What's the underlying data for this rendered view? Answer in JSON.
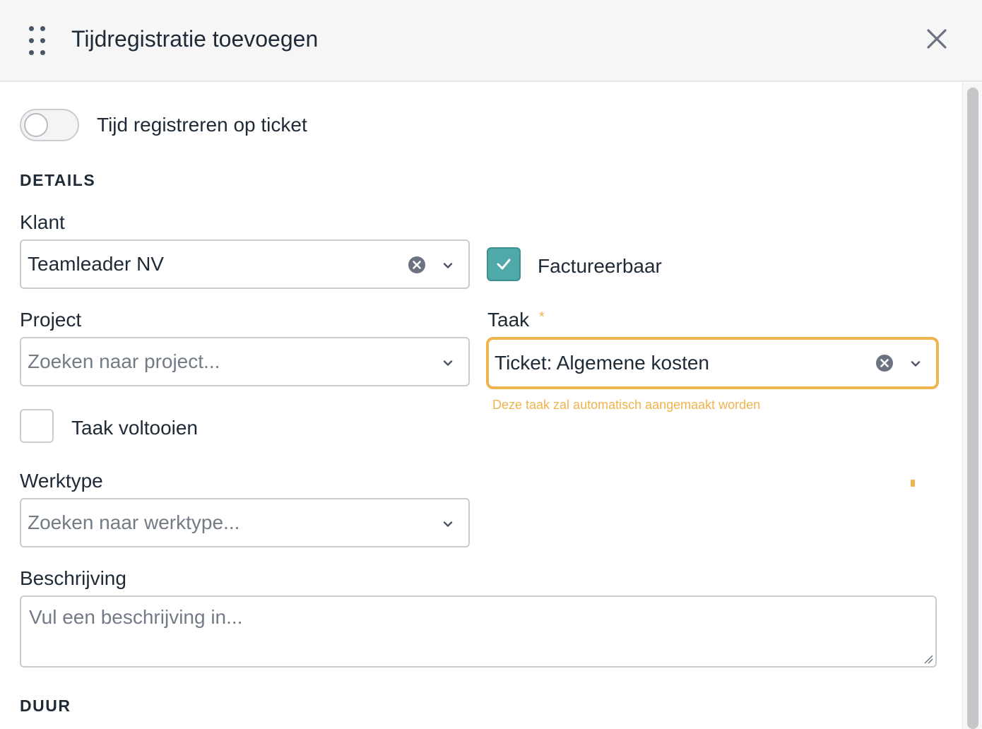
{
  "header": {
    "title": "Tijdregistratie toevoegen",
    "drag_icon": "drag-handle-icon",
    "close_icon": "close-icon"
  },
  "ticket_toggle": {
    "label": "Tijd registreren op ticket",
    "on": false
  },
  "details": {
    "section_title": "DETAILS",
    "klant": {
      "label": "Klant",
      "value": "Teamleader NV"
    },
    "factureerbaar": {
      "label": "Factureerbaar",
      "checked": true
    },
    "project": {
      "label": "Project",
      "placeholder": "Zoeken naar project..."
    },
    "taak": {
      "label": "Taak",
      "required_marker": "*",
      "value": "Ticket: Algemene kosten",
      "hint": "Deze taak zal automatisch aangemaakt worden"
    },
    "taak_voltooien": {
      "label": "Taak voltooien",
      "checked": false
    },
    "werktype": {
      "label": "Werktype",
      "placeholder": "Zoeken naar werktype..."
    },
    "beschrijving": {
      "label": "Beschrijving",
      "placeholder": "Vul een beschrijving in..."
    }
  },
  "duur": {
    "section_title": "DUUR"
  },
  "colors": {
    "accent_teal": "#4fa9a9",
    "warning_orange": "#f0b44c",
    "border_gray": "#c9ccd1",
    "header_bg": "#f6f6f7"
  }
}
